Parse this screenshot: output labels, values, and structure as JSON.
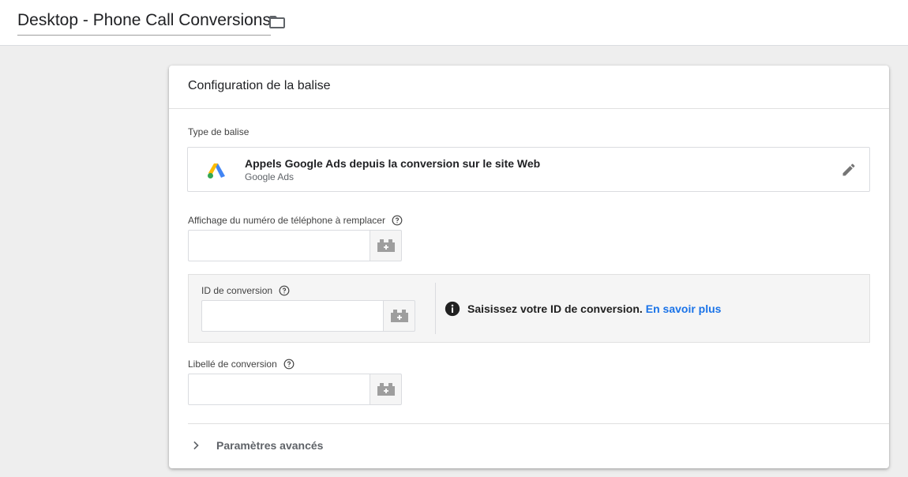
{
  "header": {
    "title": "Desktop - Phone Call Conversions",
    "folder_icon": "folder-icon"
  },
  "card": {
    "title": "Configuration de la balise",
    "tag_type": {
      "label": "Type de balise",
      "name": "Appels Google Ads depuis la conversion sur le site Web",
      "provider": "Google Ads",
      "logo_icon": "google-ads-logo",
      "edit_icon": "pencil-icon"
    },
    "phone_field": {
      "label": "Affichage du numéro de téléphone à remplacer",
      "value": ""
    },
    "conversion_id": {
      "label": "ID de conversion",
      "value": "",
      "info_text": "Saisissez votre ID de conversion.",
      "info_link": "En savoir plus"
    },
    "conversion_label": {
      "label": "Libellé de conversion",
      "value": ""
    },
    "advanced": {
      "label": "Paramètres avancés"
    }
  },
  "colors": {
    "accent_link": "#1a73e8",
    "background": "#eeeeee",
    "ads_blue": "#4285f4",
    "ads_yellow": "#fbbc04",
    "ads_green": "#34a853"
  }
}
